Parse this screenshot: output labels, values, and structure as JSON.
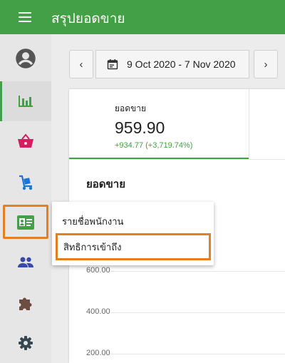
{
  "header": {
    "title": "สรุปยอดขาย",
    "menu_icon": "hamburger-icon"
  },
  "sidebar": {
    "items": [
      {
        "name": "account",
        "icon": "account-circle-icon",
        "color": "#555555"
      },
      {
        "name": "sales-report",
        "icon": "bar-chart-icon",
        "color": "#43a047",
        "active": true
      },
      {
        "name": "orders",
        "icon": "basket-icon",
        "color": "#d81b60"
      },
      {
        "name": "inventory",
        "icon": "hand-truck-icon",
        "color": "#1976d2"
      },
      {
        "name": "staff",
        "icon": "id-card-icon",
        "color": "#43a047",
        "highlighted": true
      },
      {
        "name": "customers",
        "icon": "people-icon",
        "color": "#3949ab"
      },
      {
        "name": "integrations",
        "icon": "puzzle-icon",
        "color": "#6d4c41"
      },
      {
        "name": "settings",
        "icon": "gear-icon",
        "color": "#37474f"
      }
    ]
  },
  "date_bar": {
    "range": "9 Oct 2020 - 7 Nov 2020",
    "prev_icon": "chevron-left-icon",
    "next_icon": "chevron-right-icon",
    "calendar_icon": "calendar-icon"
  },
  "metric": {
    "label": "ยอดขาย",
    "value": "959.90",
    "change": "+934.77 (+3,719.74%)"
  },
  "chart": {
    "title": "ยอดขาย",
    "y_labels": [
      "600.00",
      "400.00",
      "200.00"
    ]
  },
  "dropdown": {
    "items": [
      "รายชื่อพนักงาน",
      "สิทธิการเข้าถึง"
    ]
  },
  "colors": {
    "primary": "#43a047",
    "highlight": "#e67e22"
  }
}
